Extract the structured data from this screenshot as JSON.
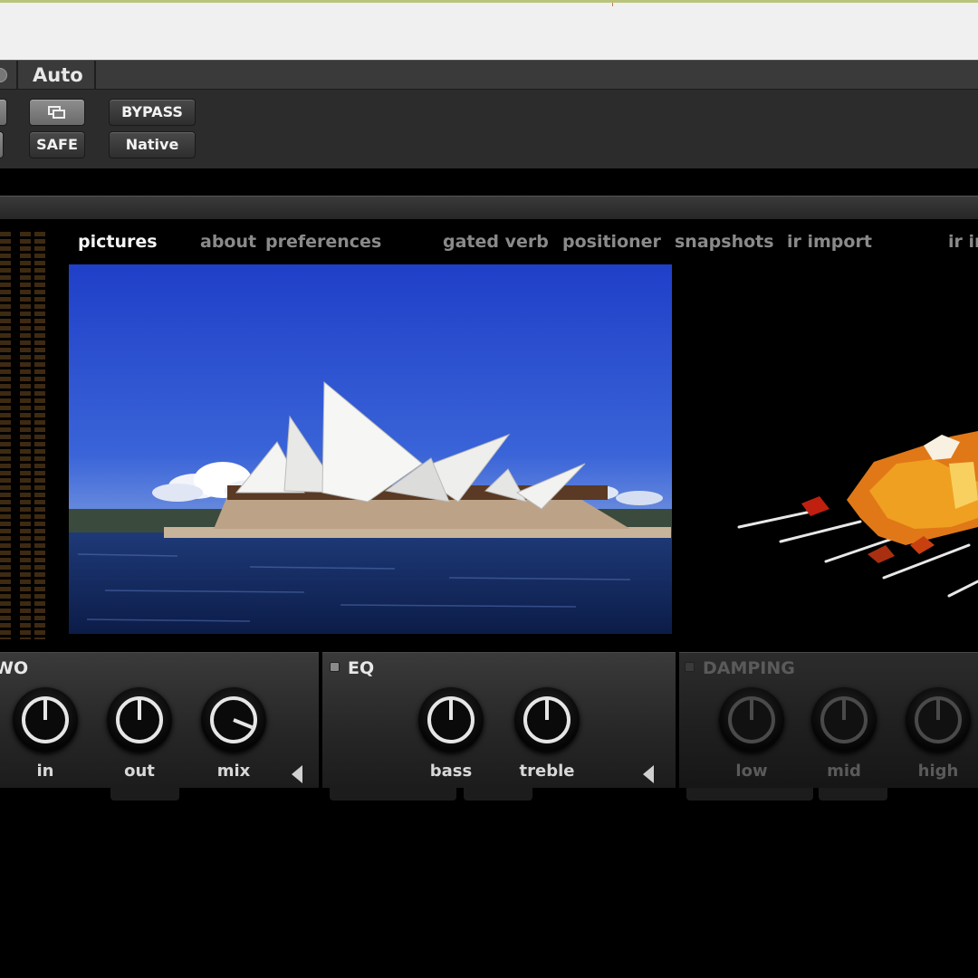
{
  "header": {
    "auto_label": "Auto",
    "bypass_label": "BYPASS",
    "safe_label": "SAFE",
    "native_label": "Native",
    "compare_icon": "window-compare-icon"
  },
  "nav": {
    "items": [
      "pictures",
      "about",
      "preferences",
      "gated verb",
      "positioner",
      "snapshots",
      "ir import",
      "ir in"
    ],
    "active": "pictures"
  },
  "photo": {
    "subject": "opera-house-photo"
  },
  "sections": {
    "io": {
      "title": "WO",
      "knobs": [
        {
          "label": "in"
        },
        {
          "label": "out"
        },
        {
          "label": "mix"
        }
      ]
    },
    "eq": {
      "title": "EQ",
      "knobs": [
        {
          "label": "bass"
        },
        {
          "label": "treble"
        }
      ]
    },
    "damping": {
      "title": "DAMPING",
      "knobs": [
        {
          "label": "low"
        },
        {
          "label": "mid"
        },
        {
          "label": "high"
        }
      ]
    }
  },
  "colors": {
    "accent_meter": "#3e2a12",
    "active_text": "#f5f5f5",
    "inactive_text": "#8a8a8a"
  }
}
